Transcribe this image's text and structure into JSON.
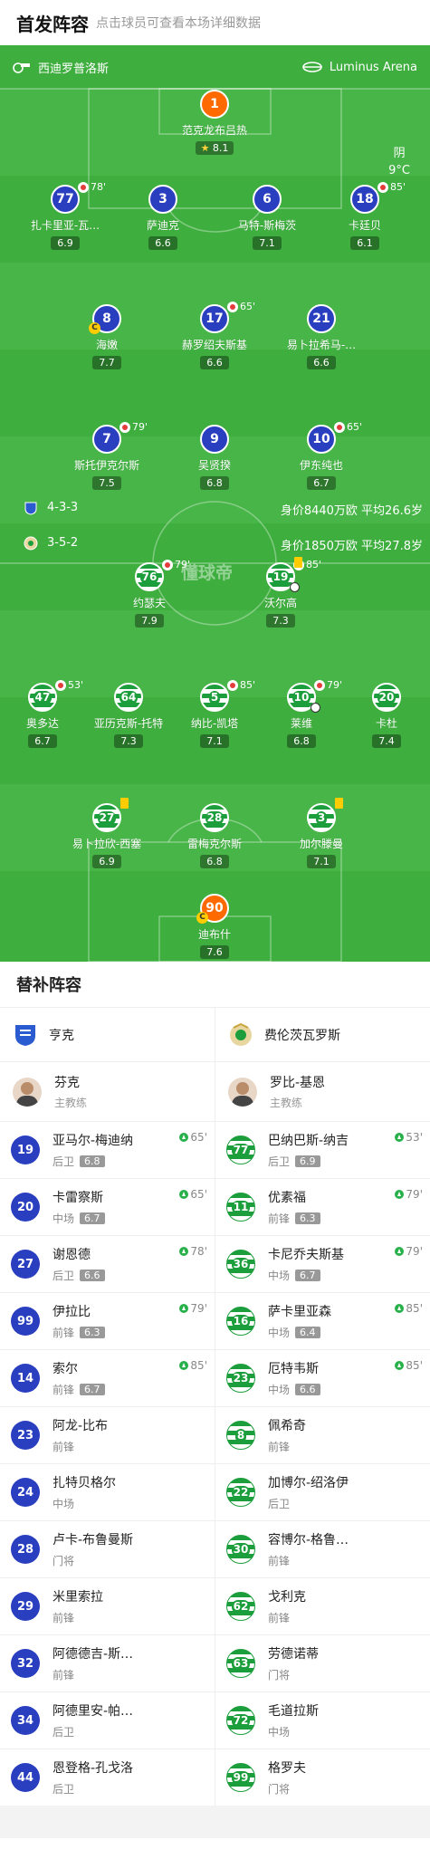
{
  "header": {
    "title": "首发阵容",
    "subtitle": "点击球员可查看本场详细数据"
  },
  "venue": {
    "left": "西迪罗普洛斯",
    "right": "Luminus Arena"
  },
  "weather": {
    "condition": "阴",
    "temperature": "9°C"
  },
  "watermark": "懂球帝",
  "home_team_line": {
    "formation": "4-3-3",
    "value": "身价8440万欧",
    "avg_age": "平均26.6岁"
  },
  "away_team_line": {
    "formation": "3-5-2",
    "value": "身价1850万欧",
    "avg_age": "平均27.8岁"
  },
  "home_players": [
    {
      "number": "1",
      "name": "范克龙布吕热",
      "rating": "8.1",
      "gk": true,
      "star": true
    },
    {
      "number": "77",
      "name": "扎卡里亚-瓦…",
      "rating": "6.9",
      "sub": "78'"
    },
    {
      "number": "3",
      "name": "萨迪克",
      "rating": "6.6"
    },
    {
      "number": "6",
      "name": "马特-斯梅茨",
      "rating": "7.1"
    },
    {
      "number": "18",
      "name": "卡廷贝",
      "rating": "6.1",
      "sub": "85'"
    },
    {
      "number": "8",
      "name": "海嫩",
      "rating": "7.7",
      "captain": "C"
    },
    {
      "number": "17",
      "name": "赫罗绍夫斯基",
      "rating": "6.6",
      "sub": "65'"
    },
    {
      "number": "21",
      "name": "易卜拉希马-…",
      "rating": "6.6"
    },
    {
      "number": "7",
      "name": "斯托伊克尔斯",
      "rating": "7.5",
      "sub": "79'"
    },
    {
      "number": "9",
      "name": "吴贤揆",
      "rating": "6.8"
    },
    {
      "number": "10",
      "name": "伊东纯也",
      "rating": "6.7",
      "sub": "65'"
    }
  ],
  "away_players": [
    {
      "number": "76",
      "name": "约瑟夫",
      "rating": "7.9",
      "sub": "79'"
    },
    {
      "number": "19",
      "name": "沃尔高",
      "rating": "7.3",
      "sub": "85'",
      "card": "yellow",
      "goal": true
    },
    {
      "number": "47",
      "name": "奥多达",
      "rating": "6.7",
      "sub": "53'"
    },
    {
      "number": "64",
      "name": "亚历克斯-托特",
      "rating": "7.3"
    },
    {
      "number": "5",
      "name": "纳比-凯塔",
      "rating": "7.1",
      "sub": "85'"
    },
    {
      "number": "10",
      "name": "莱维",
      "rating": "6.8",
      "sub": "79'",
      "goal": true
    },
    {
      "number": "20",
      "name": "卡杜",
      "rating": "7.4"
    },
    {
      "number": "27",
      "name": "易卜拉欣-西塞",
      "rating": "6.9",
      "card": "yellow"
    },
    {
      "number": "28",
      "name": "雷梅克尔斯",
      "rating": "6.8"
    },
    {
      "number": "3",
      "name": "加尔滕曼",
      "rating": "7.1",
      "card": "yellow"
    },
    {
      "number": "90",
      "name": "迪布什",
      "rating": "7.6",
      "gk": true,
      "captain": "C"
    }
  ],
  "subs_section": {
    "title": "替补阵容"
  },
  "home_subs": {
    "team": "亨克",
    "coach": {
      "name": "芬克",
      "role": "主教练"
    },
    "players": [
      {
        "number": "19",
        "name": "亚马尔-梅迪纳",
        "pos": "后卫",
        "rating": "6.8",
        "min": "65'"
      },
      {
        "number": "20",
        "name": "卡雷察斯",
        "pos": "中场",
        "rating": "6.7",
        "min": "65'"
      },
      {
        "number": "27",
        "name": "谢恩德",
        "pos": "后卫",
        "rating": "6.6",
        "min": "78'"
      },
      {
        "number": "99",
        "name": "伊拉比",
        "pos": "前锋",
        "rating": "6.3",
        "min": "79'"
      },
      {
        "number": "14",
        "name": "索尔",
        "pos": "前锋",
        "rating": "6.7",
        "min": "85'"
      },
      {
        "number": "23",
        "name": "阿龙-比布",
        "pos": "前锋"
      },
      {
        "number": "24",
        "name": "扎特贝格尔",
        "pos": "中场"
      },
      {
        "number": "28",
        "name": "卢卡-布鲁曼斯",
        "pos": "门将"
      },
      {
        "number": "29",
        "name": "米里索拉",
        "pos": "前锋"
      },
      {
        "number": "32",
        "name": "阿德德吉-斯…",
        "pos": "前锋"
      },
      {
        "number": "34",
        "name": "阿德里安-帕…",
        "pos": "后卫"
      },
      {
        "number": "44",
        "name": "恩登格-孔戈洛",
        "pos": "后卫"
      }
    ]
  },
  "away_subs": {
    "team": "费伦茨瓦罗斯",
    "coach": {
      "name": "罗比-基恩",
      "role": "主教练"
    },
    "players": [
      {
        "number": "77",
        "name": "巴纳巴斯-纳吉",
        "pos": "后卫",
        "rating": "6.9",
        "min": "53'"
      },
      {
        "number": "11",
        "name": "优素福",
        "pos": "前锋",
        "rating": "6.3",
        "min": "79'"
      },
      {
        "number": "36",
        "name": "卡尼乔夫斯基",
        "pos": "中场",
        "rating": "6.7",
        "min": "79'"
      },
      {
        "number": "16",
        "name": "萨卡里亚森",
        "pos": "中场",
        "rating": "6.4",
        "min": "85'"
      },
      {
        "number": "23",
        "name": "厄特韦斯",
        "pos": "中场",
        "rating": "6.6",
        "min": "85'"
      },
      {
        "number": "8",
        "name": "佩希奇",
        "pos": "前锋"
      },
      {
        "number": "22",
        "name": "加博尔-绍洛伊",
        "pos": "后卫"
      },
      {
        "number": "30",
        "name": "容博尔-格鲁…",
        "pos": "前锋"
      },
      {
        "number": "62",
        "name": "戈利克",
        "pos": "前锋"
      },
      {
        "number": "63",
        "name": "劳德诺蒂",
        "pos": "门将"
      },
      {
        "number": "72",
        "name": "毛道拉斯",
        "pos": "中场"
      },
      {
        "number": "99",
        "name": "格罗夫",
        "pos": "门将"
      }
    ]
  }
}
